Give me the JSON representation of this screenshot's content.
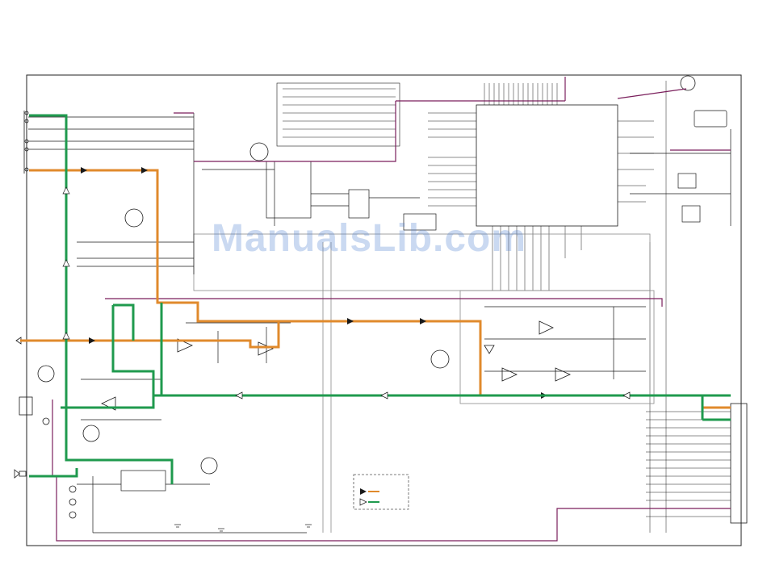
{
  "watermark": {
    "text": "ManualsLib.com"
  },
  "colors": {
    "frame": "#222222",
    "wire": "#1a1a1a",
    "grey_wire": "#8a8a8a",
    "orange_path": "#e08a2c",
    "green_path": "#1f9a4e",
    "purple_path": "#7a1f5c",
    "watermark": "#5082d2"
  },
  "legend": {
    "items": [
      {
        "arrow": "solid-black-arrow",
        "line_color": "#e08a2c"
      },
      {
        "arrow": "outline-arrow",
        "line_color": "#1f9a4e"
      }
    ]
  },
  "icons": {
    "jack_left_mid": "phone-jack-icon",
    "jack_left_bottom": "speaker-connector-icon",
    "connector_right": "multi-pin-connector-icon",
    "ground_symbol": "ground-icon"
  }
}
